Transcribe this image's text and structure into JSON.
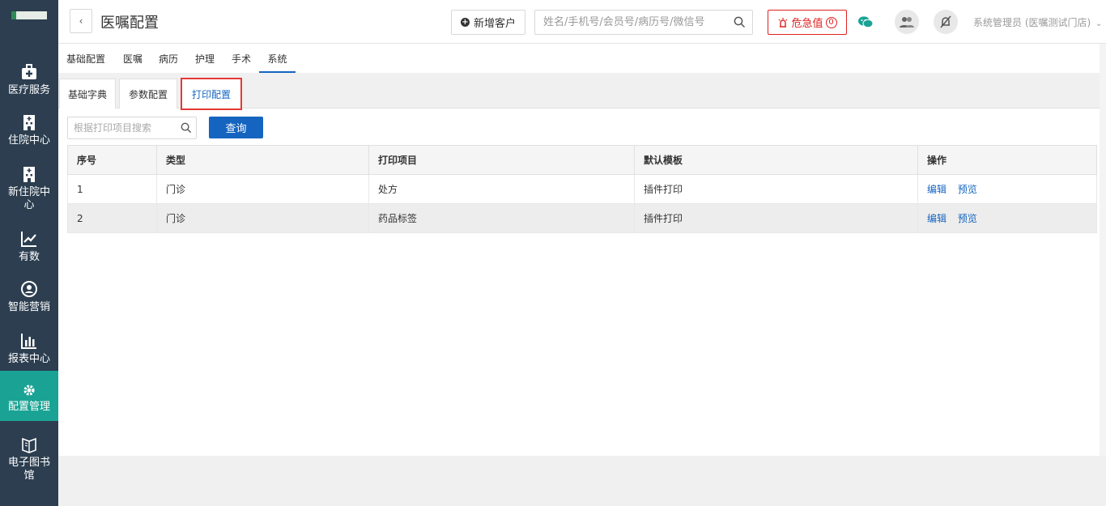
{
  "sidebar": {
    "items": [
      {
        "label": "医疗服务",
        "icon": "medical-kit-icon"
      },
      {
        "label": "住院中心",
        "icon": "hospital-building-icon"
      },
      {
        "label": "新住院中心",
        "icon": "hospital-building-icon"
      },
      {
        "label": "有数",
        "icon": "trend-chart-icon"
      },
      {
        "label": "智能营销",
        "icon": "user-circle-icon"
      },
      {
        "label": "报表中心",
        "icon": "bar-chart-icon"
      },
      {
        "label": "配置管理",
        "icon": "gear-icon"
      },
      {
        "label": "电子图书馆",
        "icon": "book-icon"
      }
    ],
    "active_index": 6,
    "active_color": "#1aa394"
  },
  "header": {
    "title": "医嘱配置",
    "new_customer_label": "新增客户",
    "search_placeholder": "姓名/手机号/会员号/病历号/微信号",
    "danger_label": "危急值",
    "danger_count": "0",
    "user_label": "系统管理员 (医嘱测试门店)"
  },
  "top_tabs": [
    {
      "label": "基础配置"
    },
    {
      "label": "医嘱"
    },
    {
      "label": "病历"
    },
    {
      "label": "护理"
    },
    {
      "label": "手术"
    },
    {
      "label": "系统"
    }
  ],
  "sub_tabs": [
    {
      "label": "基础字典"
    },
    {
      "label": "参数配置"
    },
    {
      "label": "打印配置"
    }
  ],
  "filter": {
    "search_placeholder": "根据打印项目搜索",
    "query_label": "查询"
  },
  "table": {
    "headers": [
      "序号",
      "类型",
      "打印项目",
      "默认模板",
      "操作"
    ],
    "rows": [
      {
        "index": "1",
        "type": "门诊",
        "item": "处方",
        "template": "插件打印"
      },
      {
        "index": "2",
        "type": "门诊",
        "item": "药品标签",
        "template": "插件打印"
      }
    ],
    "actions": {
      "edit": "编辑",
      "preview": "预览"
    }
  },
  "colors": {
    "sidebar_bg": "#2c3e50",
    "accent_blue": "#1565c0",
    "danger_red": "#e02020",
    "highlight_box": "#e53935"
  }
}
